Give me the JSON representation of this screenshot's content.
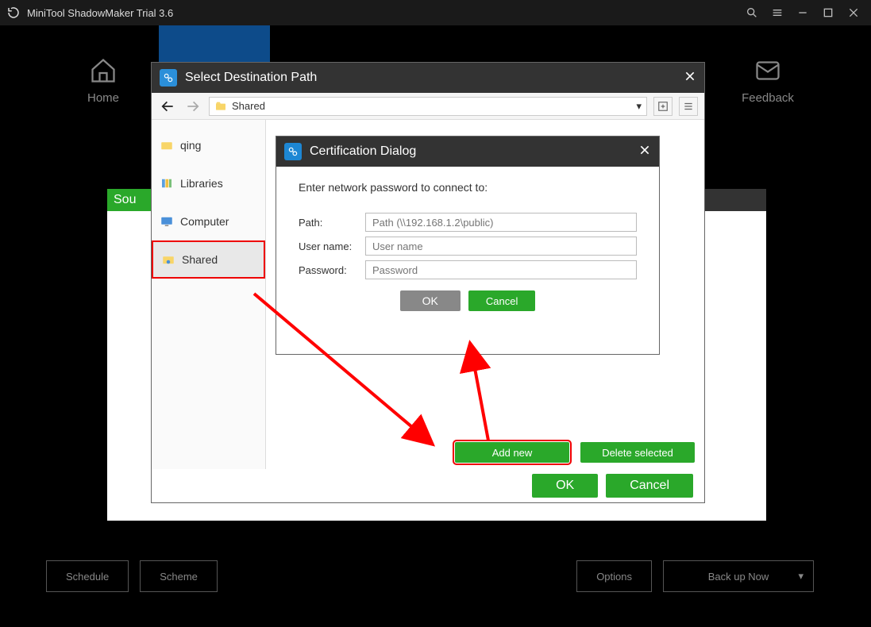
{
  "window": {
    "title": "MiniTool ShadowMaker Trial 3.6"
  },
  "tabs": {
    "home": "Home",
    "feedback": "Feedback"
  },
  "source_tab": "Sou",
  "dest_dialog": {
    "title": "Select Destination Path",
    "path_label": "Shared",
    "sidebar": {
      "qing": "qing",
      "libraries": "Libraries",
      "computer": "Computer",
      "shared": "Shared"
    },
    "add_new": "Add new",
    "delete_selected": "Delete selected",
    "ok": "OK",
    "cancel": "Cancel"
  },
  "cert_dialog": {
    "title": "Certification Dialog",
    "prompt": "Enter network password to connect to:",
    "labels": {
      "path": "Path:",
      "user": "User name:",
      "pass": "Password:"
    },
    "placeholders": {
      "path": "Path (\\\\192.168.1.2\\public)",
      "user": "User name",
      "pass": "Password"
    },
    "ok": "OK",
    "cancel": "Cancel"
  },
  "bottom": {
    "schedule": "Schedule",
    "scheme": "Scheme",
    "options": "Options",
    "backup": "Back up Now"
  }
}
